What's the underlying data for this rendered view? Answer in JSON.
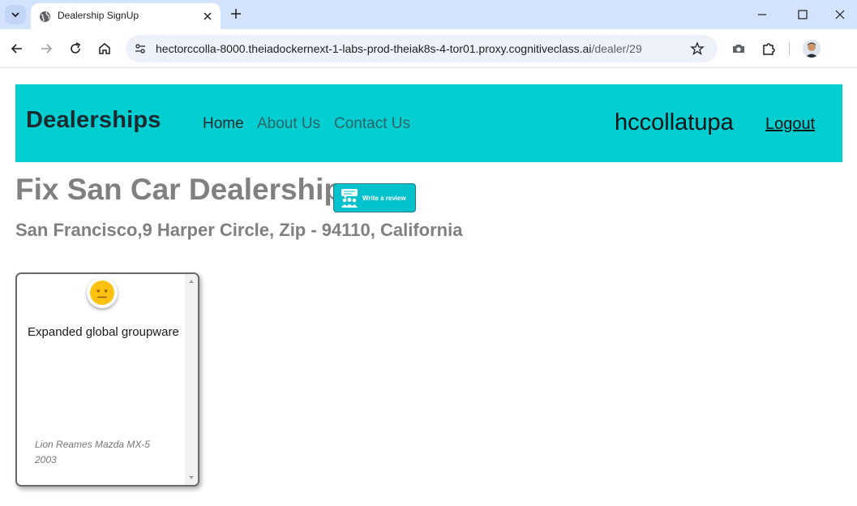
{
  "browser": {
    "tab_title": "Dealership SignUp",
    "url_host": "hectorccolla-8000.theiadockernext-1-labs-prod-theiak8s-4-tor01.proxy.cognitiveclass.ai",
    "url_path": "/dealer/29",
    "icons": [
      "tab-search-icon",
      "globe-icon",
      "close-icon",
      "plus-icon",
      "minimize-icon",
      "maximize-icon",
      "close-window-icon",
      "back-icon",
      "forward-icon",
      "reload-icon",
      "home-icon",
      "site-settings-icon",
      "star-icon",
      "camera-icon",
      "extensions-icon",
      "profile-avatar"
    ]
  },
  "navbar": {
    "brand": "Dealerships",
    "links": [
      "Home",
      "About Us",
      "Contact Us"
    ],
    "username": "hccollatupa",
    "logout": "Logout",
    "background": "#00ced1"
  },
  "dealer": {
    "name": "Fix San Car Dealership",
    "address": "San Francisco,9 Harper Circle, Zip - 94110, California",
    "review_button_label": "Write a review"
  },
  "reviews": [
    {
      "sentiment_icon": "neutral-face-icon",
      "text": "Expanded global groupware",
      "car": "Lion Reames Mazda MX-5 2003"
    }
  ]
}
